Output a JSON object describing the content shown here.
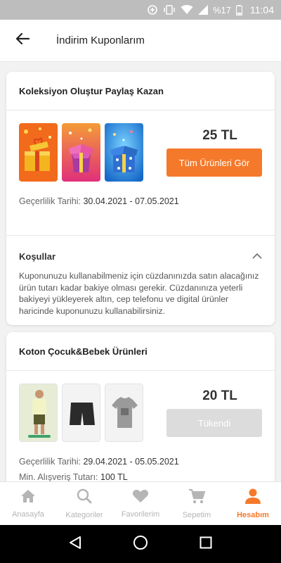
{
  "status_bar": {
    "battery_percent": "%17",
    "time": "11:04"
  },
  "header": {
    "title": "İndirim Kuponlarım",
    "back_icon": "arrow-left-icon"
  },
  "coupons": [
    {
      "title": "Koleksiyon Oluştur Paylaş Kazan",
      "amount": "25 TL",
      "button_label": "Tüm Ürünleri Gör",
      "validity_label": "Geçerlilik Tarihi:",
      "validity_value": "30.04.2021 - 07.05.2021",
      "conditions_label": "Koşullar",
      "conditions_text": "Kuponunuzu kullanabilmeniz için cüzdanınızda satın alacağınız ürün tutarı kadar bakiye olması gerekir. Cüzdanınıza yeterli bakiyeyi yükleyerek altın, cep telefonu ve digital ürünler haricinde kuponunuzu kullanabilirsiniz.",
      "images": [
        "gift-box-orange",
        "gift-box-pink",
        "gift-box-blue"
      ]
    },
    {
      "title": "Koton Çocuk&Bebek Ürünleri",
      "amount": "20 TL",
      "button_label": "Tükendi",
      "validity_label": "Geçerlilik Tarihi:",
      "validity_value": "29.04.2021 - 05.05.2021",
      "min_label": "Min. Alışveriş Tutarı:",
      "min_value": "100 TL",
      "images": [
        "kid-outfit-photo",
        "black-shorts-photo",
        "grey-tshirt-photo"
      ]
    }
  ],
  "bottom_nav": [
    {
      "label": "Anasayfa",
      "icon": "home-icon",
      "active": false
    },
    {
      "label": "Kategoriler",
      "icon": "search-icon",
      "active": false
    },
    {
      "label": "Favorilerim",
      "icon": "heart-icon",
      "active": false
    },
    {
      "label": "Sepetim",
      "icon": "cart-icon",
      "active": false
    },
    {
      "label": "Hesabım",
      "icon": "user-icon",
      "active": true
    }
  ],
  "colors": {
    "accent": "#f5792a",
    "inactive": "#b5b5b5",
    "disabled_button": "#dcdcdc"
  }
}
